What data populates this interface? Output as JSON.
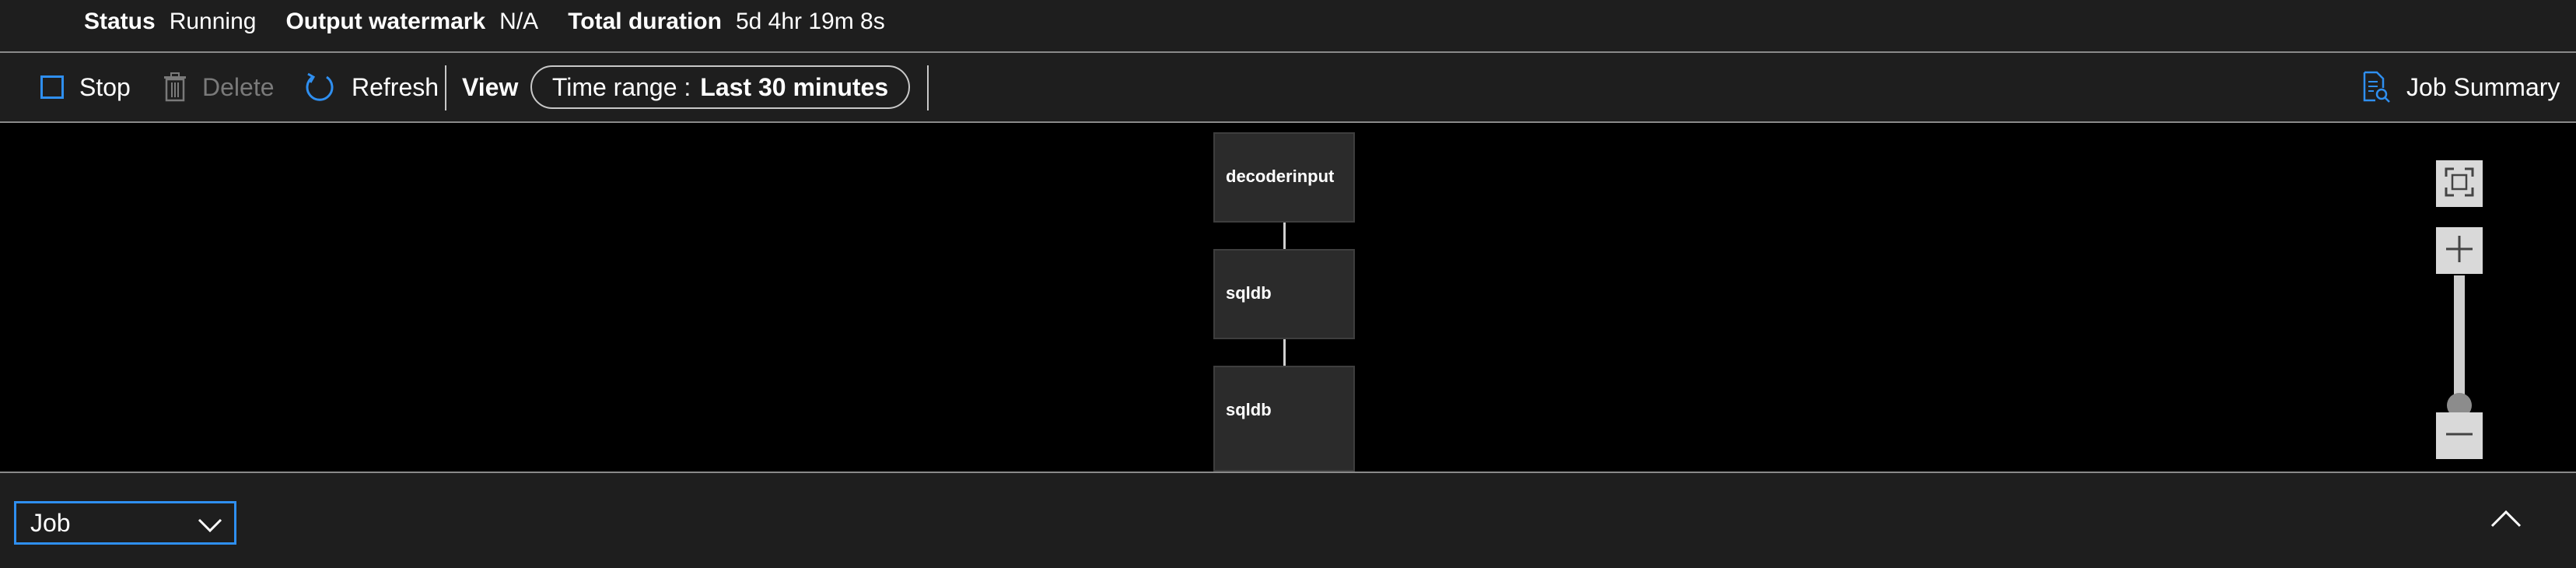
{
  "essentials": {
    "status_label": "Status",
    "status_value": "Running",
    "watermark_label": "Output watermark",
    "watermark_value": "N/A",
    "duration_label": "Total duration",
    "duration_value": "5d 4hr 19m 8s"
  },
  "toolbar": {
    "stop_label": "Stop",
    "delete_label": "Delete",
    "refresh_label": "Refresh",
    "view_label": "View",
    "time_range_label": "Time range :",
    "time_range_value": "Last 30 minutes",
    "job_summary_label": "Job Summary",
    "delete_enabled": false
  },
  "diagram": {
    "nodes": [
      {
        "label": "decoderinput"
      },
      {
        "label": "sqldb"
      },
      {
        "label": "sqldb"
      }
    ]
  },
  "zoom": {
    "fit_icon": "fit-to-screen-icon",
    "zoom_in_icon": "plus-icon",
    "zoom_out_icon": "minus-icon",
    "level_fraction": 0.1
  },
  "bottom": {
    "view_select_value": "Job",
    "collapse_icon": "chevron-up-icon"
  },
  "colors": {
    "accent": "#2f8ff0",
    "background": "#000000",
    "panel": "#1e1e1e"
  }
}
